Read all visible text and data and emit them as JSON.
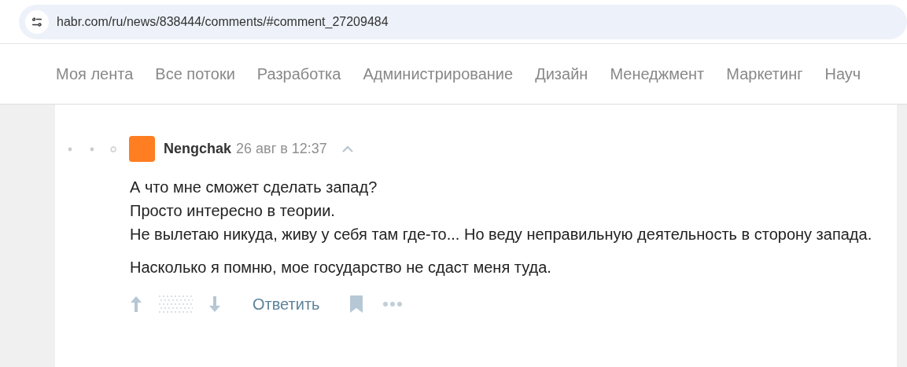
{
  "address_bar": {
    "url": "habr.com/ru/news/838444/comments/#comment_27209484"
  },
  "nav": {
    "items": [
      "Моя лента",
      "Все потоки",
      "Разработка",
      "Администрирование",
      "Дизайн",
      "Менеджмент",
      "Маркетинг",
      "Науч"
    ]
  },
  "comment": {
    "author": "Nengchak",
    "time": "26 авг в 12:37",
    "paragraphs": [
      "А что мне сможет сделать запад?\nПросто интересно в теории.\nНе вылетаю никуда, живу у себя там где-то... Но веду неправильную деятельность в сторону запада.",
      "Насколько я помню, мое государство не сдаст меня туда."
    ],
    "reply_label": "Ответить"
  }
}
